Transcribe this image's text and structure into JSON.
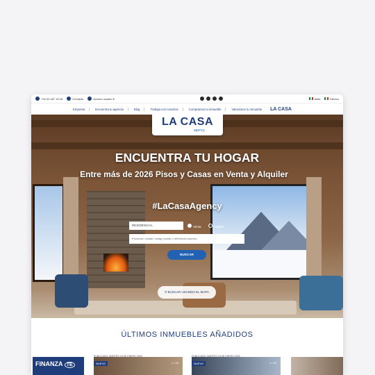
{
  "topbar": {
    "phone": "+34 93 487 18 26",
    "contact": "Contacto",
    "user_access": "Acceso usuario ▾",
    "lang_italy": "Italia",
    "lang_mexico": "México"
  },
  "nav": {
    "items": [
      "Empresa",
      "Encuentra tu agencia",
      "Blog",
      "Trabaja con nosotros",
      "Compramos tu inmueble",
      "Valoramos tu inmueble"
    ],
    "logo_text": "LA CASA"
  },
  "hero": {
    "logo_main": "LA CASA",
    "logo_sub": "agency",
    "title": "ENCUENTRA TU HOGAR",
    "subtitle": "Entre más de 2026 Pisos y Casas en Venta y Alquiler",
    "hashtag": "#LaCasaAgency"
  },
  "search": {
    "type_value": "RESIDENCIAL",
    "radio_sale": "Venta",
    "radio_rent": "Alquiler",
    "placeholder": "Provincia, ciudad, código postal o referencia anuncio",
    "button": "BUSCAR",
    "map_button": "BUSCAR USANDO EL MAPA"
  },
  "listings": {
    "title": "ÚLTIMOS INMUEBLES AÑADIDOS",
    "finanza": "FINANZA",
    "finanza_badge": "TE",
    "date1": "PUBLICADO: MARTES 19 DE ENERO 2026",
    "date2": "PUBLICADO: MARTES 19 DE ENERO 2026",
    "badge_new": "NUEVO",
    "count1": "1 / 25",
    "count2": "1 / 23"
  },
  "colors": {
    "brand": "#1f3d7a",
    "button": "#2361b3"
  }
}
